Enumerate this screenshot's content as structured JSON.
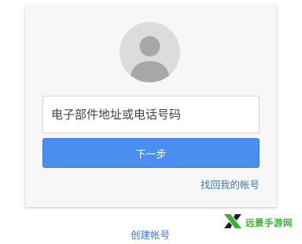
{
  "signin": {
    "email_placeholder": "电子部件地址或电话号码",
    "next_label": "下一步",
    "find_account_label": "找回我的帐号"
  },
  "footer": {
    "create_account_label": "创建帐号"
  },
  "watermark": {
    "text": "远景手游网"
  },
  "colors": {
    "primary_button": "#4a8ef0",
    "link": "#3f76c8",
    "avatar_bg": "#dcdcdc",
    "watermark": "#3fae36"
  }
}
